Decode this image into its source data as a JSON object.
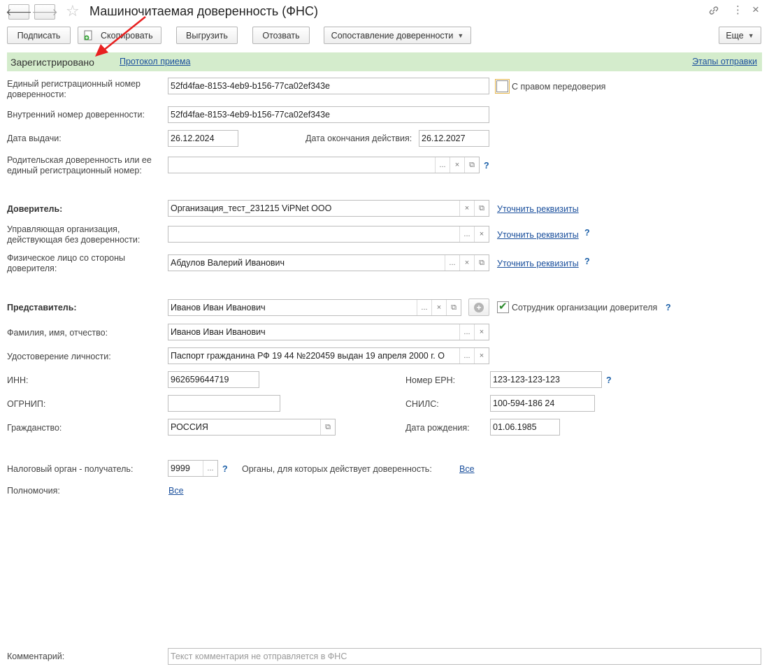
{
  "window": {
    "title": "Машиночитаемая доверенность (ФНС)"
  },
  "toolbar": {
    "sign": "Подписать",
    "copy": "Скопировать",
    "export": "Выгрузить",
    "revoke": "Отозвать",
    "compare": "Сопоставление доверенности",
    "more": "Еще"
  },
  "status": {
    "text": "Зарегистрировано",
    "protocol_link": "Протокол приема",
    "stages_link": "Этапы отправки"
  },
  "form": {
    "reg_number": {
      "label": "Единый регистрационный номер доверенности:",
      "value": "52fd4fae-8153-4eb9-b156-77ca02ef343e"
    },
    "redelegation": {
      "label": "С правом передоверия",
      "checked": false
    },
    "internal_number": {
      "label": "Внутренний номер доверенности:",
      "value": "52fd4fae-8153-4eb9-b156-77ca02ef343e"
    },
    "issue_date": {
      "label": "Дата выдачи:",
      "value": "26.12.2024"
    },
    "end_date": {
      "label": "Дата окончания действия:",
      "value": "26.12.2027"
    },
    "parent": {
      "label": "Родительская доверенность или ее единый регистрационный номер:",
      "value": ""
    },
    "principal": {
      "label": "Доверитель:",
      "value": "Организация_тест_231215 ViPNet ООО",
      "link": "Уточнить реквизиты"
    },
    "managing_org": {
      "label": "Управляющая организация, действующая без доверенности:",
      "value": "",
      "link": "Уточнить реквизиты"
    },
    "principal_person": {
      "label": "Физическое лицо со стороны доверителя:",
      "value": "Абдулов Валерий Иванович",
      "link": "Уточнить реквизиты"
    },
    "representative": {
      "label": "Представитель:",
      "value": "Иванов Иван Иванович"
    },
    "employee": {
      "label": "Сотрудник организации доверителя",
      "checked": true
    },
    "full_name": {
      "label": "Фамилия, имя, отчество:",
      "value": "Иванов Иван Иванович"
    },
    "id_doc": {
      "label": "Удостоверение личности:",
      "value": "Паспорт гражданина РФ 19 44 №220459 выдан 19 апреля 2000 г. О"
    },
    "inn": {
      "label": "ИНН:",
      "value": "962659644719"
    },
    "ern": {
      "label": "Номер ЕРН:",
      "value": "123-123-123-123"
    },
    "ogrnip": {
      "label": "ОГРНИП:",
      "value": ""
    },
    "snils": {
      "label": "СНИЛС:",
      "value": "100-594-186 24"
    },
    "citizenship": {
      "label": "Гражданство:",
      "value": "РОССИЯ"
    },
    "birth_date": {
      "label": "Дата рождения:",
      "value": "01.06.1985"
    },
    "tax_authority": {
      "label": "Налоговый орган - получатель:",
      "value": "9999"
    },
    "bodies": {
      "label": "Органы, для которых действует доверенность:",
      "link": "Все"
    },
    "powers": {
      "label": "Полномочия:",
      "link": "Все"
    },
    "comment": {
      "label": "Комментарий:",
      "placeholder": "Текст комментария не отправляется в ФНС"
    }
  },
  "glyphs": {
    "back": "🡐",
    "forward": "🡒",
    "star": "☆",
    "link": "🔗",
    "menu": "⋮",
    "close": "×",
    "dots": "...",
    "clear": "×",
    "open": "⧉",
    "help": "?",
    "plus": "+"
  },
  "colors": {
    "status_bg": "#d4eccc",
    "link": "#1a4f9c",
    "annotation_arrow": "#e82020"
  }
}
